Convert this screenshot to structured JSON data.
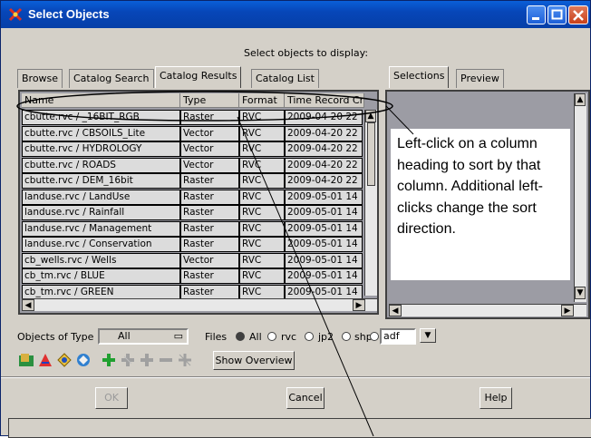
{
  "window": {
    "title": "Select Objects"
  },
  "prompt": "Select objects to display:",
  "left_tabs": [
    {
      "label": "Browse",
      "active": false
    },
    {
      "label": "Catalog Search",
      "active": false
    },
    {
      "label": "Catalog Results",
      "active": true
    },
    {
      "label": "Catalog List",
      "active": false
    }
  ],
  "right_tabs": [
    {
      "label": "Selections",
      "active": true
    },
    {
      "label": "Preview",
      "active": false
    }
  ],
  "grid": {
    "columns": [
      "Name",
      "Type",
      "Format",
      "Time Record Cre"
    ],
    "rows": [
      [
        "cbutte.rvc / _16BIT_RGB",
        "Raster",
        "RVC",
        "2009-04-20  22"
      ],
      [
        "cbutte.rvc / CBSOILS_Lite",
        "Vector",
        "RVC",
        "2009-04-20  22"
      ],
      [
        "cbutte.rvc / HYDROLOGY",
        "Vector",
        "RVC",
        "2009-04-20  22"
      ],
      [
        "cbutte.rvc / ROADS",
        "Vector",
        "RVC",
        "2009-04-20  22"
      ],
      [
        "cbutte.rvc / DEM_16bit",
        "Raster",
        "RVC",
        "2009-04-20  22"
      ],
      [
        "landuse.rvc / LandUse",
        "Raster",
        "RVC",
        "2009-05-01  14"
      ],
      [
        "landuse.rvc / Rainfall",
        "Raster",
        "RVC",
        "2009-05-01  14"
      ],
      [
        "landuse.rvc / Management",
        "Raster",
        "RVC",
        "2009-05-01  14"
      ],
      [
        "landuse.rvc / Conservation",
        "Raster",
        "RVC",
        "2009-05-01  14"
      ],
      [
        "cb_wells.rvc / Wells",
        "Vector",
        "RVC",
        "2009-05-01  14"
      ],
      [
        "cb_tm.rvc / BLUE",
        "Raster",
        "RVC",
        "2009-05-01  14"
      ],
      [
        "cb_tm.rvc / GREEN",
        "Raster",
        "RVC",
        "2009-05-01  14"
      ]
    ]
  },
  "annotation": "Left-click on a column heading to sort by that column. Additional left-clicks change the sort direction.",
  "filter": {
    "objects_label": "Objects of Type",
    "objects_value": "All",
    "files_label": "Files",
    "options": [
      {
        "label": "All",
        "selected": true
      },
      {
        "label": "rvc",
        "selected": false
      },
      {
        "label": "jp2",
        "selected": false
      },
      {
        "label": "shp",
        "selected": false
      },
      {
        "label": "",
        "selected": false
      }
    ],
    "ext_value": "adf"
  },
  "toolbar": {
    "icons": [
      "raster-select-icon",
      "vector-select-icon",
      "cad-select-icon",
      "tin-select-icon",
      "add-icon",
      "add-all-icon",
      "add-selected-icon",
      "remove-icon",
      "remove-all-icon"
    ],
    "show_overview": "Show Overview"
  },
  "buttons": {
    "ok": "OK",
    "cancel": "Cancel",
    "help": "Help"
  },
  "colors": {
    "titlebar": "#0746b8",
    "dialog": "#d4d0c8",
    "grid_bg": "#9c9ca4",
    "cell_bg": "#dcdcdc"
  }
}
